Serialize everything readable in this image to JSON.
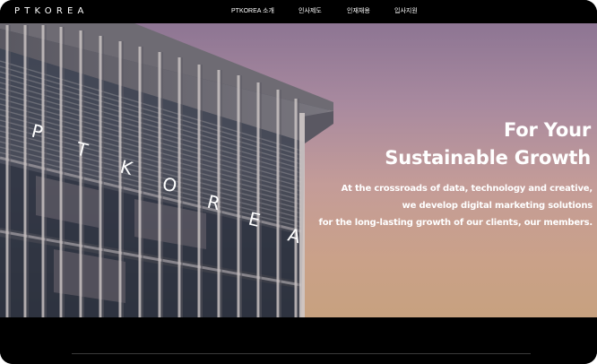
{
  "brand": {
    "logo_text": "PTKOREA"
  },
  "nav": {
    "items": [
      {
        "label": "PTKOREA 소개"
      },
      {
        "label": "인사제도"
      },
      {
        "label": "인재채용"
      },
      {
        "label": "입사지원"
      }
    ]
  },
  "hero": {
    "image_name": "ptkorea-building-photo",
    "sign_letters": [
      "P",
      "T",
      "K",
      "O",
      "R",
      "E",
      "A"
    ],
    "title_line1": "For Your",
    "title_line2": "Sustainable Growth",
    "desc_line1": "At the crossroads of data, technology and creative,",
    "desc_line2": "we develop digital marketing solutions",
    "desc_line3": "for the long-lasting growth of our clients, our members."
  },
  "colors": {
    "nav_bg": "#000000",
    "sky_top": "#8d7593",
    "sky_bottom": "#c7a17f",
    "text": "#ffffff"
  }
}
